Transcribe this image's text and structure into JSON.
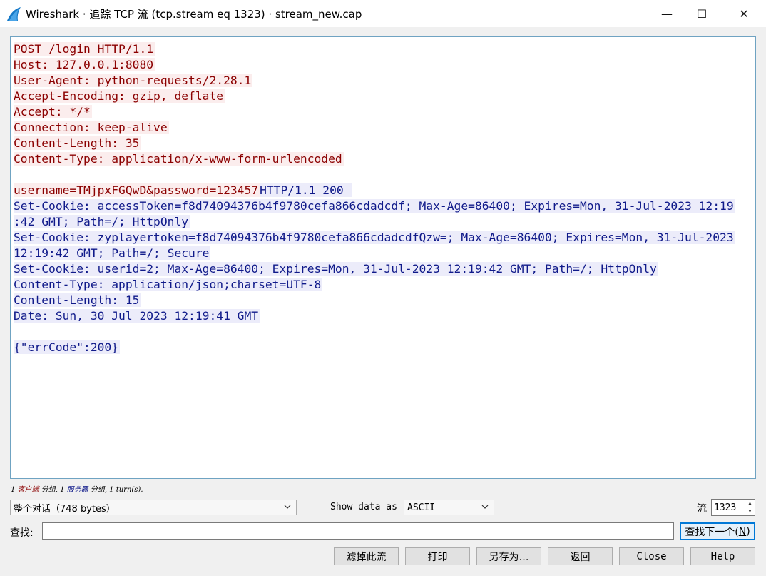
{
  "window": {
    "title": "Wireshark · 追踪 TCP 流 (tcp.stream eq 1323) · stream_new.cap",
    "app_icon": "wireshark-fin-icon",
    "minimize": "—",
    "maximize": "☐",
    "close": "✕"
  },
  "colors": {
    "client_text": "#8b0000",
    "client_bg": "#fbeded",
    "server_text": "#101a8a",
    "server_bg": "#ececfa",
    "accent": "#0078d7"
  },
  "stream": {
    "lines": [
      [
        {
          "who": "client",
          "text": "POST /login HTTP/1.1"
        }
      ],
      [
        {
          "who": "client",
          "text": "Host: 127.0.0.1:8080"
        }
      ],
      [
        {
          "who": "client",
          "text": "User-Agent: python-requests/2.28.1"
        }
      ],
      [
        {
          "who": "client",
          "text": "Accept-Encoding: gzip, deflate"
        }
      ],
      [
        {
          "who": "client",
          "text": "Accept: */*"
        }
      ],
      [
        {
          "who": "client",
          "text": "Connection: keep-alive"
        }
      ],
      [
        {
          "who": "client",
          "text": "Content-Length: 35"
        }
      ],
      [
        {
          "who": "client",
          "text": "Content-Type: application/x-www-form-urlencoded"
        }
      ],
      [],
      [
        {
          "who": "client",
          "text": "username=TMjpxFGQwD&password=123457"
        },
        {
          "who": "server",
          "text": "HTTP/1.1 200 "
        }
      ],
      [
        {
          "who": "server",
          "text": "Set-Cookie: accessToken=f8d74094376b4f9780cefa866cdadcdf; Max-Age=86400; Expires=Mon, 31-Jul-2023 12:19"
        }
      ],
      [
        {
          "who": "server",
          "text": ":42 GMT; Path=/; HttpOnly"
        }
      ],
      [
        {
          "who": "server",
          "text": "Set-Cookie: zyplayertoken=f8d74094376b4f9780cefa866cdadcdfQzw=; Max-Age=86400; Expires=Mon, 31-Jul-2023"
        }
      ],
      [
        {
          "who": "server",
          "text": "12:19:42 GMT; Path=/; Secure"
        }
      ],
      [
        {
          "who": "server",
          "text": "Set-Cookie: userid=2; Max-Age=86400; Expires=Mon, 31-Jul-2023 12:19:42 GMT; Path=/; HttpOnly"
        }
      ],
      [
        {
          "who": "server",
          "text": "Content-Type: application/json;charset=UTF-8"
        }
      ],
      [
        {
          "who": "server",
          "text": "Content-Length: 15"
        }
      ],
      [
        {
          "who": "server",
          "text": "Date: Sun, 30 Jul 2023 12:19:41 GMT"
        }
      ],
      [],
      [
        {
          "who": "server",
          "text": "{\"errCode\":200}"
        }
      ]
    ]
  },
  "status": {
    "client_count": "1",
    "client_word": "客户端",
    "mid1": " 分组, 1 ",
    "server_word": "服务器",
    "tail": " 分组, 1 turn(s)."
  },
  "controls": {
    "conversation_select": "整个对话（748 bytes）",
    "show_data_as_label": "Show data as",
    "show_data_as_value": "ASCII",
    "stream_label": "流",
    "stream_number": "1323",
    "chevron_icon": "chevron-down-icon"
  },
  "find": {
    "label": "查找:",
    "value": "",
    "next_button": "查找下一个(",
    "next_hotkey": "N",
    "next_tail": ")"
  },
  "buttons": {
    "filter": "滤掉此流",
    "print": "打印",
    "save_as": "另存为…",
    "back": "返回",
    "close": "Close",
    "help": "Help"
  }
}
